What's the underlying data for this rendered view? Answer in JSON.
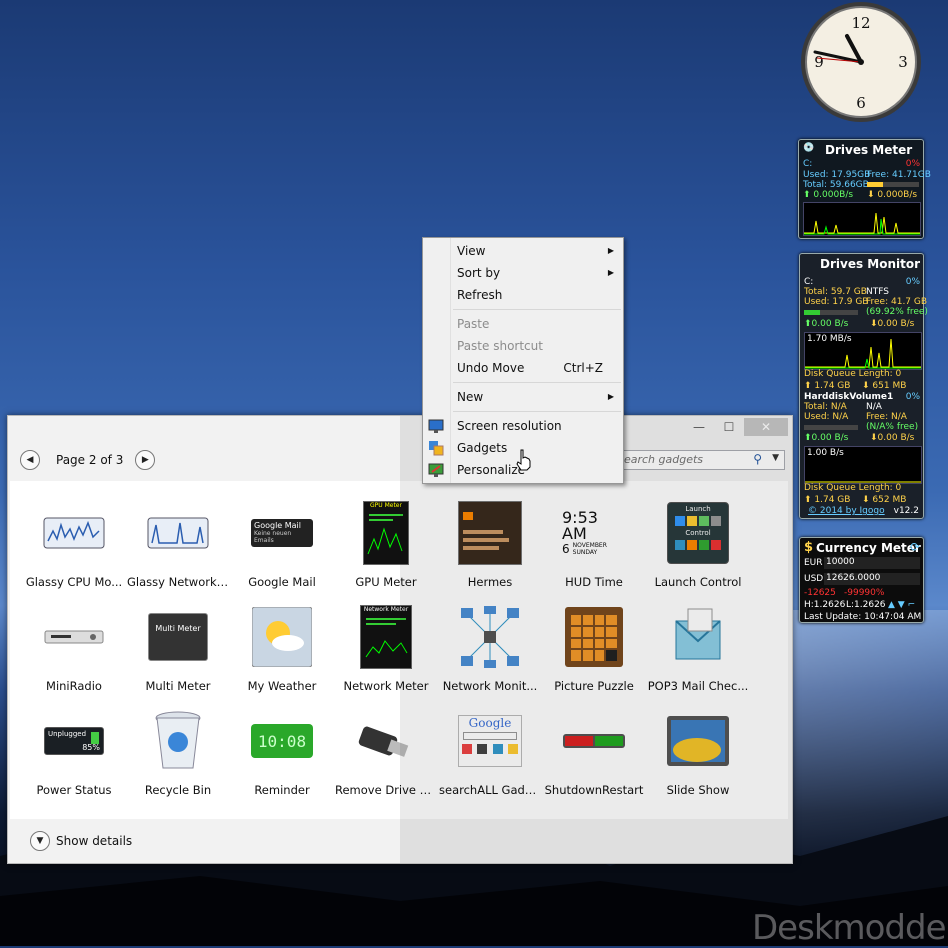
{
  "context_menu": {
    "view": "View",
    "sort_by": "Sort by",
    "refresh": "Refresh",
    "paste": "Paste",
    "paste_shortcut": "Paste shortcut",
    "undo_move": "Undo Move",
    "undo_shortcut": "Ctrl+Z",
    "new": "New",
    "screen_resolution": "Screen resolution",
    "gadgets": "Gadgets",
    "personalize": "Personalize"
  },
  "gallery": {
    "page_label": "Page 2 of 3",
    "search_placeholder": "Search gadgets",
    "show_details": "Show details",
    "items": [
      "Glassy CPU Mo...",
      "Glassy Network ...",
      "Google Mail",
      "GPU Meter",
      "Hermes",
      "HUD Time",
      "Launch Control",
      "MiniRadio",
      "Multi Meter",
      "My Weather",
      "Network Meter",
      "Network Monit...",
      "Picture Puzzle",
      "POP3 Mail Chec...",
      "Power Status",
      "Recycle Bin",
      "Reminder",
      "Remove Drive S...",
      "searchALL Gadg...",
      "ShutdownRestart",
      "Slide Show"
    ],
    "thumb_text": {
      "google_mail": "Google Mail",
      "google_mail_sub": "Keine neuen Emails",
      "gpu_meter": "GPU Meter",
      "hud_time": "9:53 AM",
      "hud_day": "6",
      "hud_month": "NOVEMBER",
      "hud_weekday": "SUNDAY",
      "launch": "Launch",
      "control": "Control",
      "multi_meter": "Multi Meter",
      "network_meter": "Network Meter",
      "power_status": "Unplugged",
      "power_pct": "85%",
      "reminder": "10:08",
      "google": "Google"
    }
  },
  "clock": {
    "n12": "12",
    "n3": "3",
    "n6": "6",
    "n9": "9"
  },
  "drives_meter": {
    "title": "Drives Meter",
    "drive": "C:",
    "pct": "0%",
    "used": "Used: 17.95GB",
    "free": "Free: 41.71GB",
    "total": "Total: 59.66GB",
    "up": "0.000B/s",
    "down": "0.000B/s",
    "used_fraction": 0.3
  },
  "drives_monitor": {
    "title": "Drives Monitor",
    "c_drive": "C:",
    "c_pct": "0%",
    "c_total": "Total: 59.7 GB",
    "c_fs": "NTFS",
    "c_used": "Used: 17.9 GB",
    "c_free": "Free: 41.7 GB",
    "c_free_pct": "(69.92% free)",
    "c_up": "0.00 B/s",
    "c_down": "0.00 B/s",
    "c_graph": "1.70 MB/s",
    "c_queue": "Disk Queue Length: 0",
    "c_read": "1.74 GB",
    "c_write": "651 MB",
    "h_name": "HarddiskVolume1",
    "h_pct": "0%",
    "h_total": "Total: N/A",
    "h_total_val": "N/A",
    "h_used": "Used: N/A",
    "h_free": "Free: N/A",
    "h_free_pct": "(N/A% free)",
    "h_up": "0.00 B/s",
    "h_down": "0.00 B/s",
    "h_graph": "1.00 B/s",
    "h_queue": "Disk Queue Length: 0",
    "h_read": "1.74 GB",
    "h_write": "652 MB",
    "credit": "© 2014 by Igogo",
    "version": "v12.2",
    "c_used_fraction": 0.3
  },
  "currency": {
    "title": "Currency Meter",
    "eur_label": "EUR",
    "eur_value": "10000",
    "usd_label": "USD",
    "usd_value": "12626.0000",
    "change": "-12625",
    "change_pct": "-99990%",
    "high": "H:1.2626",
    "low": "L:1.2626",
    "updated": "Last Update: 10:47:04 AM"
  },
  "watermark": "Deskmodder.de"
}
